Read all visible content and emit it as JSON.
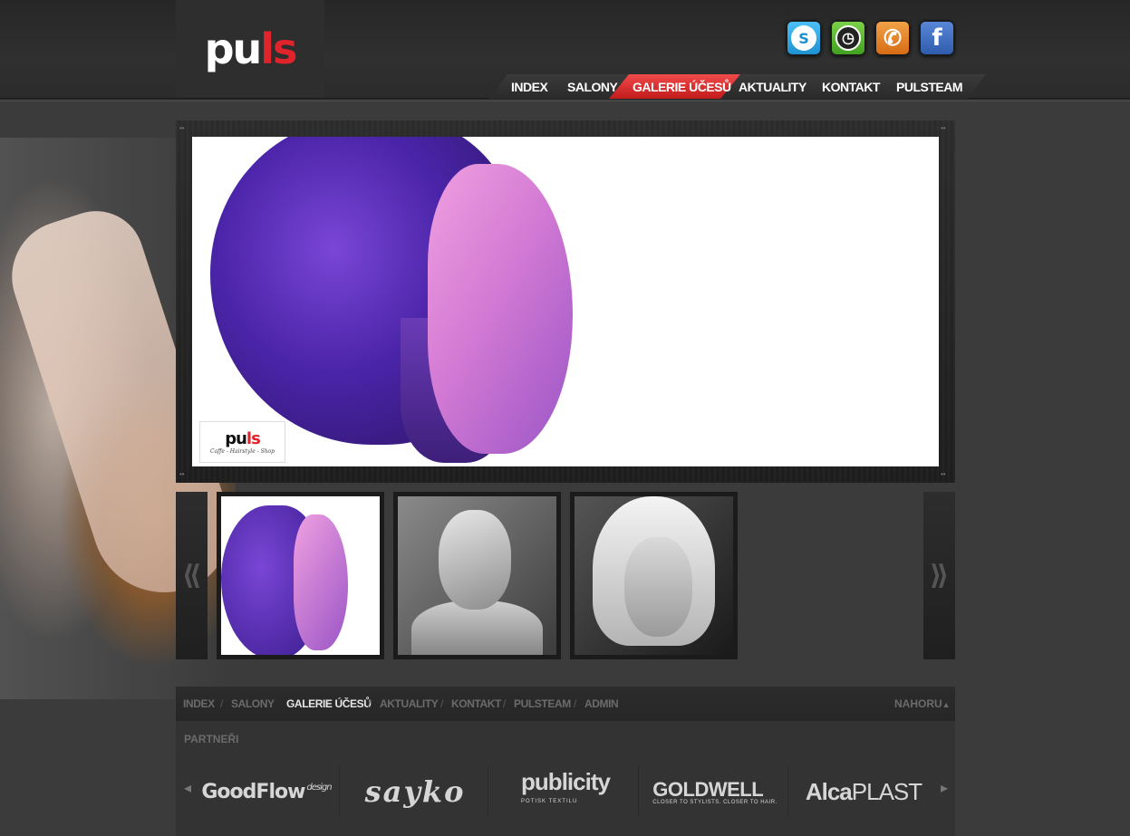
{
  "logo": {
    "text_black": "pu",
    "text_red": "ls"
  },
  "contact_icons": [
    {
      "icon": "skype-icon",
      "color": "#2aa7e4"
    },
    {
      "icon": "clock-icon",
      "color": "#5fbd33"
    },
    {
      "icon": "phone-icon",
      "color": "#e8872c"
    },
    {
      "icon": "facebook-icon",
      "color": "#3b6ac2"
    }
  ],
  "nav": {
    "active": "GALERIE ÚČESŮ",
    "items": [
      "INDEX",
      "SALONY",
      "GALERIE ÚČESŮ",
      "AKTUALITY",
      "KONTAKT",
      "PULSTEAM"
    ]
  },
  "viewer": {
    "watermark_logo_black": "pu",
    "watermark_logo_red": "ls",
    "watermark_tagline": "Caffe - Hairstyle - Shop"
  },
  "thumbnails": {
    "prev": "⟪",
    "next": "⟫"
  },
  "footer_nav": {
    "items": [
      "INDEX",
      "SALONY",
      "GALERIE ÚČESŮ",
      "AKTUALITY",
      "KONTAKT",
      "PULSTEAM",
      "ADMIN"
    ],
    "separator": "/",
    "to_top": "NAHORU"
  },
  "partners": {
    "title": "PARTNEŘI",
    "logos": {
      "goodflow": "GoodFlow",
      "goodflow_sup": "design",
      "sayko": "sayko",
      "publicity": "publicity",
      "publicity_sub": "POTISK TEXTILU",
      "goldwell": "GOLDWELL",
      "goldwell_sub": "CLOSER TO STYLISTS. CLOSER TO HAIR.",
      "alcaplast_a": "Alca",
      "alcaplast_b": "PLAST"
    }
  },
  "colors": {
    "accent_red": "#e0242c",
    "background": "#3a3a3a"
  }
}
